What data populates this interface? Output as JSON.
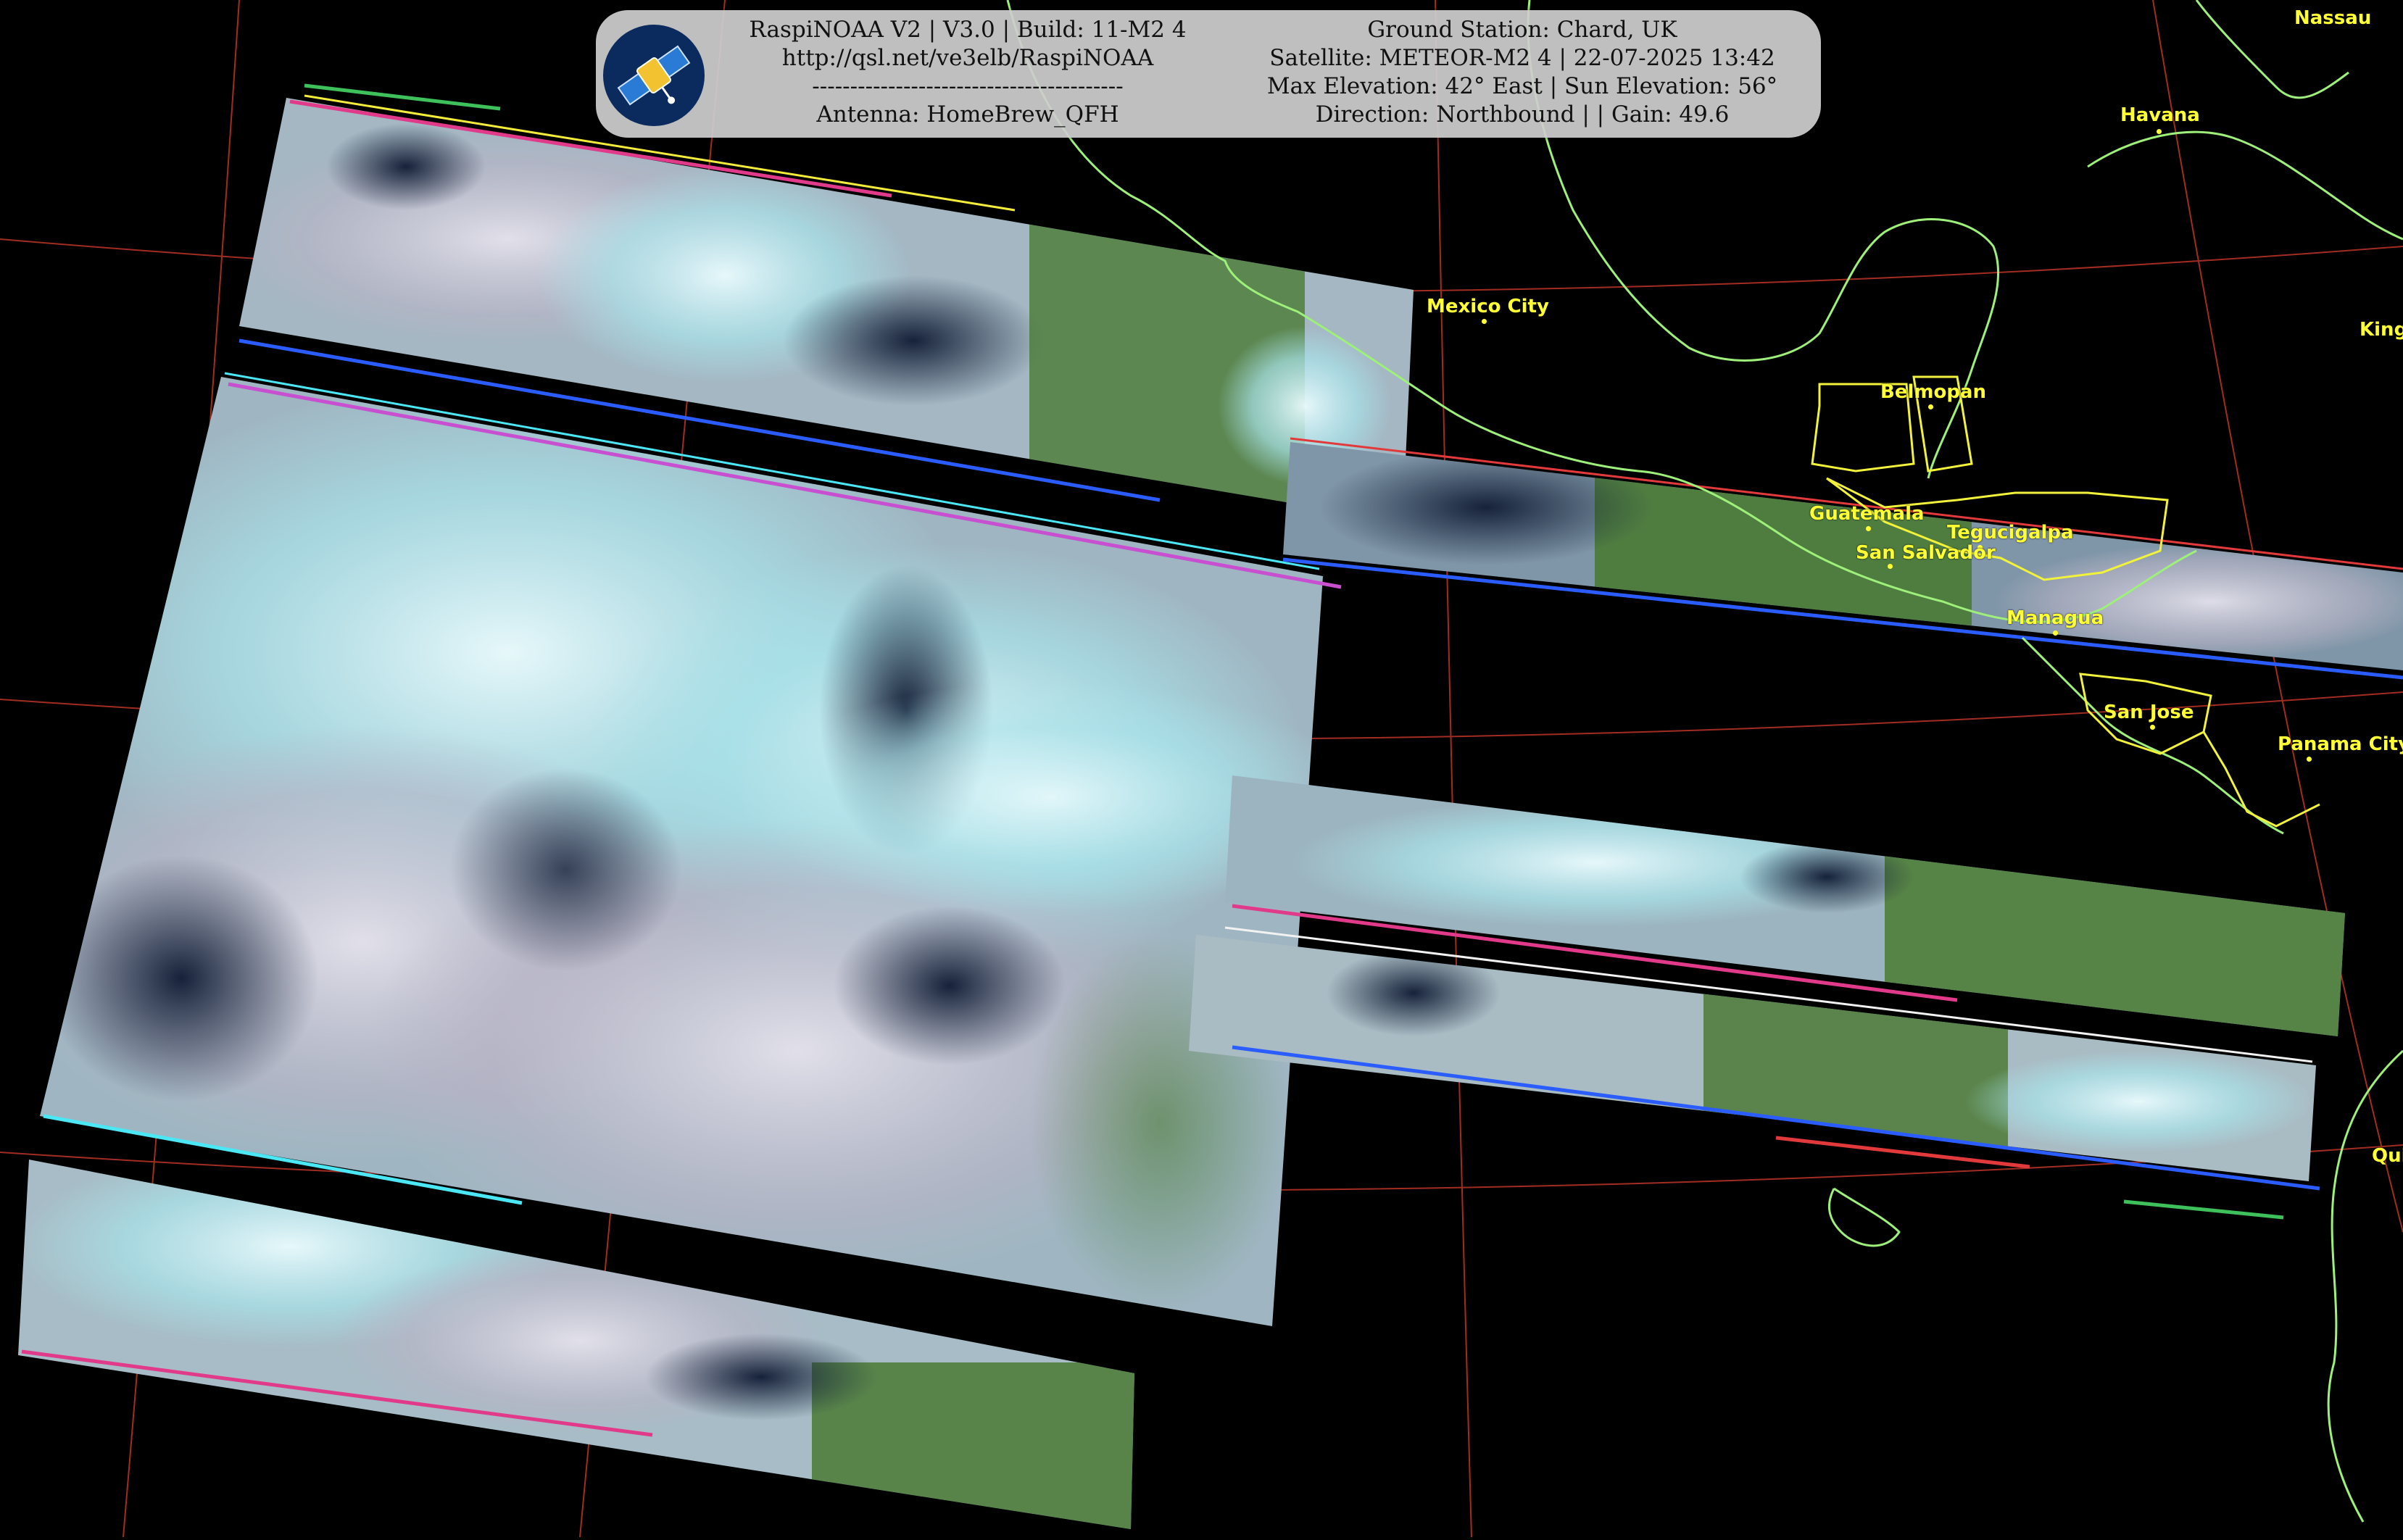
{
  "info_panel": {
    "left_lines": [
      "RaspiNOAA V2 | V3.0 | Build: 11-M2 4",
      "http://qsl.net/ve3elb/RaspiNOAA",
      "-----------------------------------------",
      "Antenna: HomeBrew_QFH"
    ],
    "right_lines": [
      "Ground Station: Chard, UK",
      "Satellite: METEOR-M2 4 | 22-07-2025 13:42",
      "Max Elevation: 42° East | Sun Elevation: 56°",
      "Direction: Northbound | | Gain: 49.6"
    ],
    "logo_icon": "satellite-icon"
  },
  "cities": [
    {
      "name": "Nassau"
    },
    {
      "name": "Havana"
    },
    {
      "name": "Mexico City"
    },
    {
      "name": "King"
    },
    {
      "name": "Belmopan"
    },
    {
      "name": "Guatemala"
    },
    {
      "name": "Tegucigalpa"
    },
    {
      "name": "San Salvador"
    },
    {
      "name": "Managua"
    },
    {
      "name": "San Jose"
    },
    {
      "name": "Panama City"
    },
    {
      "name": "Qui"
    }
  ],
  "colors": {
    "background": "#000000",
    "city_label": "#ffff33",
    "coastline": "#9ef07a",
    "border": "#f2f23a",
    "graticule": "#c0392b",
    "cloud": "#d6eef0",
    "land": "#4f7a3a",
    "ocean": "#1c2a3e"
  }
}
